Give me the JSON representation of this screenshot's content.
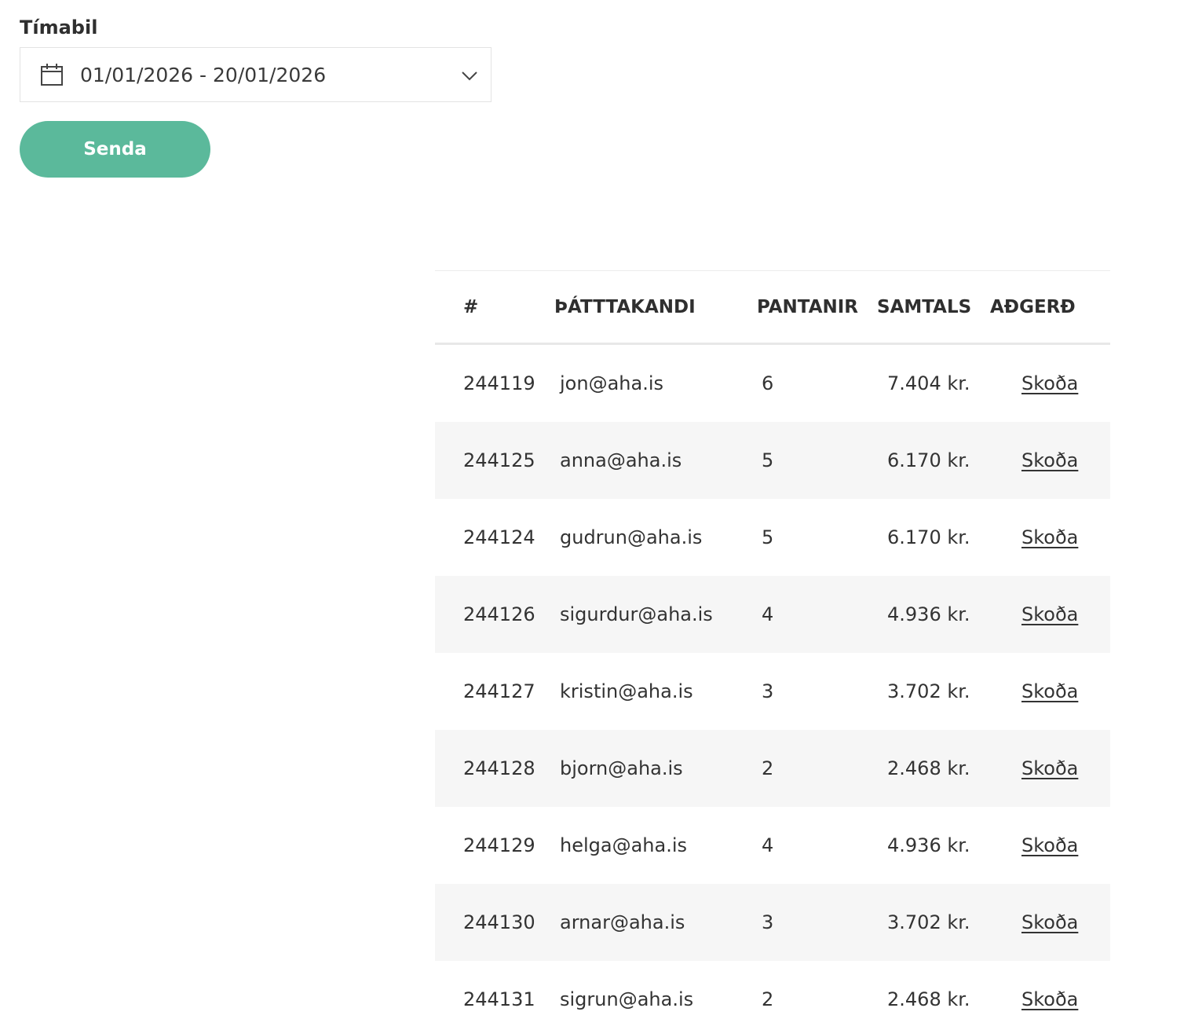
{
  "filter": {
    "label": "Tímabil",
    "date_range": "01/01/2026 - 20/01/2026",
    "icons": [
      "calendar-icon",
      "chevron-down-icon"
    ]
  },
  "send_button": {
    "label": "Senda",
    "color": "#5bb99b"
  },
  "table": {
    "headers": {
      "id": "#",
      "participant": "ÞÁTTTAKANDI",
      "orders": "PANTANIR",
      "total": "SAMTALS",
      "action": "AÐGERÐ"
    },
    "rows": [
      {
        "id": "244119",
        "participant": "jon@aha.is",
        "orders": "6",
        "total": "7.404 kr.",
        "action": "Skoða"
      },
      {
        "id": "244125",
        "participant": "anna@aha.is",
        "orders": "5",
        "total": "6.170 kr.",
        "action": "Skoða"
      },
      {
        "id": "244124",
        "participant": "gudrun@aha.is",
        "orders": "5",
        "total": "6.170 kr.",
        "action": "Skoða"
      },
      {
        "id": "244126",
        "participant": "sigurdur@aha.is",
        "orders": "4",
        "total": "4.936 kr.",
        "action": "Skoða"
      },
      {
        "id": "244127",
        "participant": "kristin@aha.is",
        "orders": "3",
        "total": "3.702 kr.",
        "action": "Skoða"
      },
      {
        "id": "244128",
        "participant": "bjorn@aha.is",
        "orders": "2",
        "total": "2.468 kr.",
        "action": "Skoða"
      },
      {
        "id": "244129",
        "participant": "helga@aha.is",
        "orders": "4",
        "total": "4.936 kr.",
        "action": "Skoða"
      },
      {
        "id": "244130",
        "participant": "arnar@aha.is",
        "orders": "3",
        "total": "3.702 kr.",
        "action": "Skoða"
      },
      {
        "id": "244131",
        "participant": "sigrun@aha.is",
        "orders": "2",
        "total": "2.468 kr.",
        "action": "Skoða"
      }
    ]
  }
}
